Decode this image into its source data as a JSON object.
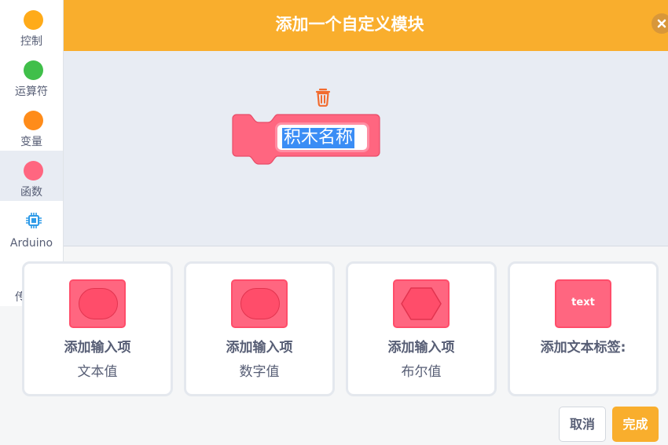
{
  "dialog": {
    "title": "添加一个自定义模块"
  },
  "sidebar": {
    "items": [
      {
        "label": "控制",
        "color": "#ffab19",
        "icon": "dot"
      },
      {
        "label": "运算符",
        "color": "#40bf4a",
        "icon": "dot"
      },
      {
        "label": "变量",
        "color": "#ff8c1a",
        "icon": "dot"
      },
      {
        "label": "函数",
        "color": "#ff6680",
        "icon": "dot",
        "selected": true
      },
      {
        "label": "Arduino",
        "color": "#2f9be8",
        "icon": "chip-icon"
      },
      {
        "label": "传感器",
        "color": "#f2a317",
        "icon": "sensor-chip-icon"
      }
    ]
  },
  "workspace": {
    "block_name": "积木名称",
    "block_color": "#ff6680"
  },
  "cards": [
    {
      "title": "添加输入项",
      "subtitle": "文本值",
      "icon": "text-input-icon"
    },
    {
      "title": "添加输入项",
      "subtitle": "数字值",
      "icon": "number-input-icon"
    },
    {
      "title": "添加输入项",
      "subtitle": "布尔值",
      "icon": "boolean-input-icon"
    },
    {
      "title": "添加文本标签:",
      "subtitle": "",
      "icon": "text-label-icon",
      "icon_text": "text"
    }
  ],
  "footer": {
    "cancel_label": "取消",
    "ok_label": "完成"
  },
  "colors": {
    "accent": "#f9ae2d",
    "block": "#ff6680",
    "text": "#575e75"
  }
}
